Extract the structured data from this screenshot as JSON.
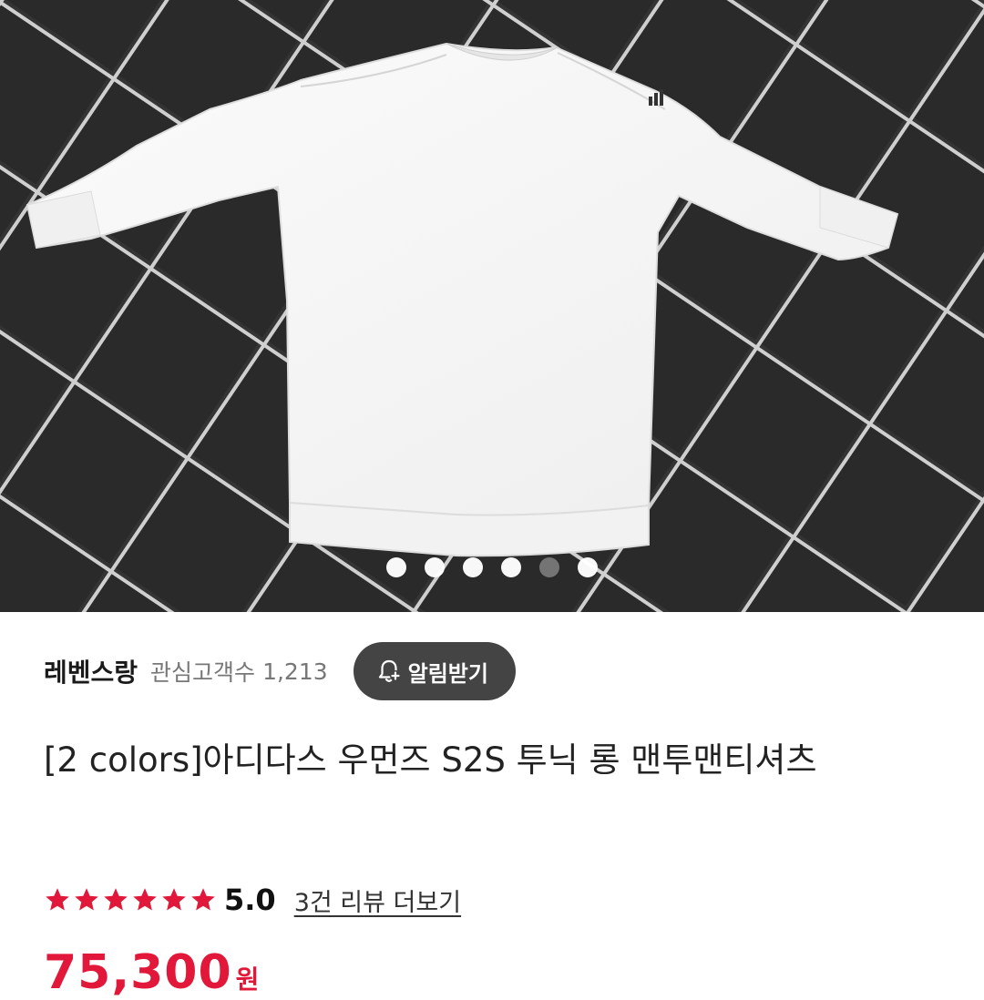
{
  "product_image": {
    "alt_icon": "white-long-sweatshirt-photo",
    "carousel": {
      "total": 6,
      "dim_index": 4
    }
  },
  "seller": {
    "name": "레벤스랑",
    "follower_label": "관심고객수",
    "follower_count": "1,213",
    "alert_button_label": "알림받기",
    "alert_icon": "bell-plus-icon"
  },
  "product": {
    "title": "[2 colors]아디다스 우먼즈 S2S 투닉 롱 맨투맨티셔츠",
    "rating": {
      "stars": 6,
      "value": "5.0",
      "review_link": "3건 리뷰 더보기"
    },
    "price": "75,300",
    "currency": "원"
  },
  "colors": {
    "price_red": "#e1183a",
    "star_red": "#e1183a",
    "alert_button_bg": "#444444"
  }
}
